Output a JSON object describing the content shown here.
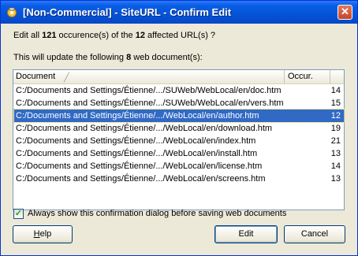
{
  "window": {
    "title": "[Non-Commercial] - SiteURL - Confirm Edit",
    "close_glyph": "✕"
  },
  "summary": {
    "prefix": "Edit all ",
    "occurrences": "121",
    "middle": " occurence(s) of the ",
    "urls": "12",
    "suffix": " affected URL(s) ?"
  },
  "update": {
    "prefix": "This will update the following ",
    "count": "8",
    "suffix": " web document(s):"
  },
  "list": {
    "headers": {
      "document": "Document",
      "occur": "Occur."
    },
    "rows": [
      {
        "path": "C:/Documents and Settings/Étienne/.../SUWeb/WebLocal/en/doc.htm",
        "occ": "14"
      },
      {
        "path": "C:/Documents and Settings/Étienne/.../SUWeb/WebLocal/en/vers.htm",
        "occ": "15"
      },
      {
        "path": "C:/Documents and Settings/Étienne/.../WebLocal/en/author.htm",
        "occ": "12"
      },
      {
        "path": "C:/Documents and Settings/Étienne/.../WebLocal/en/download.htm",
        "occ": "19"
      },
      {
        "path": "C:/Documents and Settings/Étienne/.../WebLocal/en/index.htm",
        "occ": "21"
      },
      {
        "path": "C:/Documents and Settings/Étienne/.../WebLocal/en/install.htm",
        "occ": "13"
      },
      {
        "path": "C:/Documents and Settings/Étienne/.../WebLocal/en/license.htm",
        "occ": "14"
      },
      {
        "path": "C:/Documents and Settings/Étienne/.../WebLocal/en/screens.htm",
        "occ": "13"
      }
    ],
    "selected_index": 2
  },
  "confirm_checkbox": {
    "checked": true,
    "label": "Always show this confirmation dialog before saving web documents"
  },
  "buttons": {
    "help_first": "H",
    "help_rest": "elp",
    "edit": "Edit",
    "cancel": "Cancel"
  },
  "colors": {
    "titlebar": "#0553d6",
    "selection": "#316ac5",
    "dialog_bg": "#ece9d8"
  }
}
